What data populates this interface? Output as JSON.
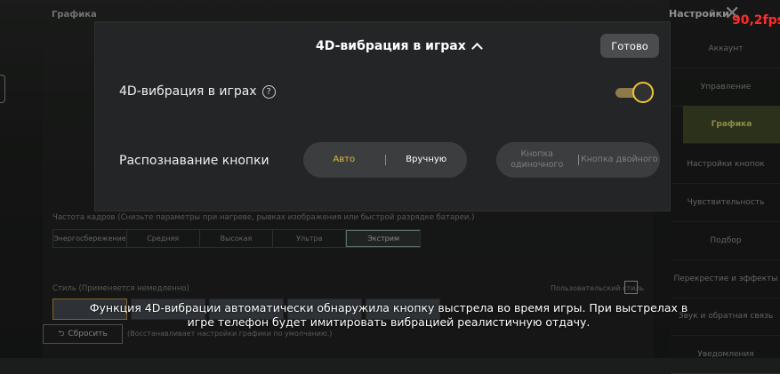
{
  "game": {
    "tab_graphics": "Графика",
    "fps_label": "Частота кадров (Снизьте параметры при нагреве, рывках изображения или быстрой разрядке батареи.)",
    "fps_options": [
      "Энергосбережение",
      "Средняя",
      "Высокая",
      "Ультра",
      "Экстрим"
    ],
    "fps_selected": "Экстрим",
    "style_label": "Стиль (Применяется немедленно)",
    "custom_style_label": "Пользовательский стиль",
    "reset_button": "Сбросить",
    "reset_note": "(Восстанавливает настройки графики по умолчанию.)"
  },
  "settings_menu": {
    "title": "Настройки",
    "fps_counter": "90,2fps",
    "items": [
      "Аккаунт",
      "Управление",
      "Графика",
      "Настройки кнопок",
      "Чувствительность",
      "Подбор",
      "Перекрестие и эффекты",
      "Звук и обратная связь",
      "Уведомления"
    ],
    "active": "Графика"
  },
  "overlay": {
    "title": "4D-вибрация в играх",
    "done_button": "Готово",
    "vibration_label": "4D-вибрация в играх",
    "vibration_enabled": true,
    "detection_label": "Распознавание кнопки",
    "mode_auto": "Авто",
    "mode_manual": "Вручную",
    "btn_single": "Кнопка одиночного",
    "btn_double": "Кнопка двойного"
  },
  "caption": "Функция 4D-вибрации автоматически обнаружила кнопку выстрела во время игры. При выстрелах в игре телефон будет имитировать вибрацией реалистичную отдачу.",
  "colors": {
    "accent_gold": "#e3ba33",
    "toggle_ring": "#f1c531",
    "fps_red": "#ff2d2d",
    "menu_active": "#47502e"
  }
}
